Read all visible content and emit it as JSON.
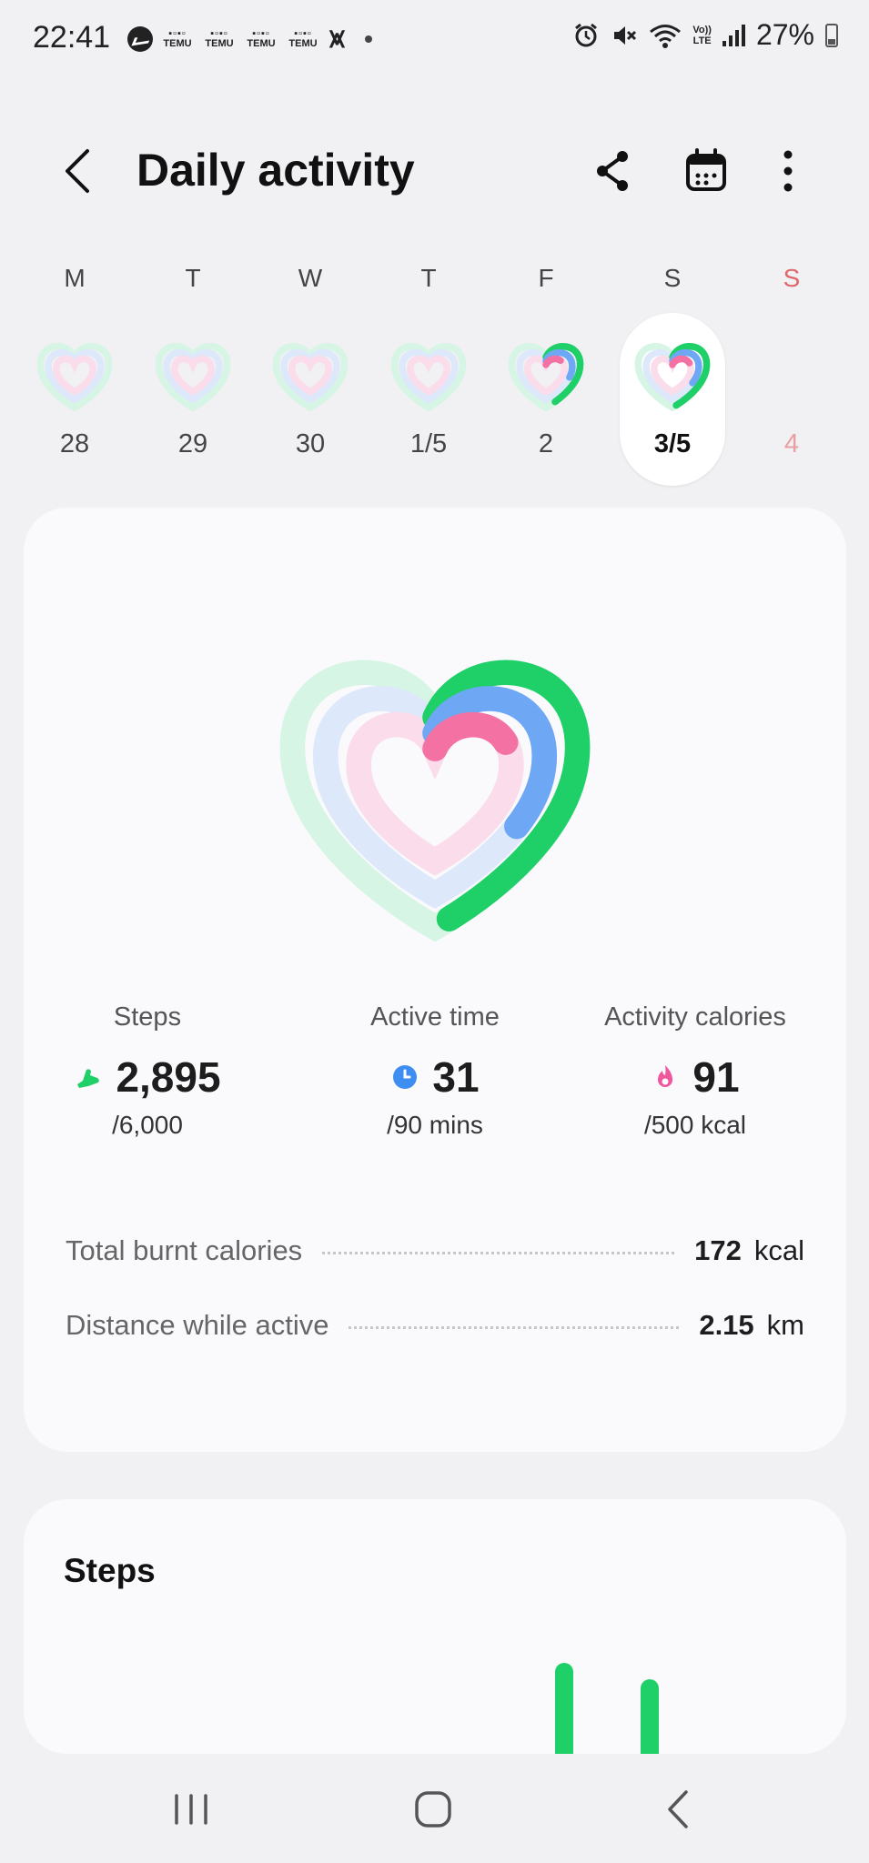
{
  "status_bar": {
    "time": "22:41",
    "temu_label": "TEMU",
    "battery": "27%",
    "icons": [
      "messenger-icon",
      "temu-icon",
      "capcut-icon",
      "alarm-icon",
      "mute-icon",
      "wifi-icon",
      "volte-icon",
      "signal-icon",
      "battery-icon"
    ],
    "volte_top": "Vo))",
    "volte_bottom": "LTE"
  },
  "header": {
    "title": "Daily activity",
    "icons": [
      "back-icon",
      "share-icon",
      "calendar-icon",
      "more-vert-icon"
    ]
  },
  "week": [
    {
      "letter": "M",
      "date": "28",
      "progress": {
        "steps": 0,
        "active": 0,
        "calories": 0
      }
    },
    {
      "letter": "T",
      "date": "29",
      "progress": {
        "steps": 0,
        "active": 0,
        "calories": 0
      }
    },
    {
      "letter": "W",
      "date": "30",
      "progress": {
        "steps": 0,
        "active": 0,
        "calories": 0
      }
    },
    {
      "letter": "T",
      "date": "1/5",
      "progress": {
        "steps": 0,
        "active": 0,
        "calories": 0
      }
    },
    {
      "letter": "F",
      "date": "2",
      "progress": {
        "steps": 0.45,
        "active": 0.3,
        "calories": 0.15
      }
    },
    {
      "letter": "S",
      "date": "3/5",
      "selected": true,
      "progress": {
        "steps": 0.48,
        "active": 0.34,
        "calories": 0.18
      }
    },
    {
      "letter": "S",
      "date": "4",
      "sunday": true
    }
  ],
  "summary": {
    "steps": {
      "label": "Steps",
      "value": "2,895",
      "goal": "/6,000",
      "icon": "shoe-icon",
      "color": "#1fcf68"
    },
    "active_time": {
      "label": "Active time",
      "value": "31",
      "goal": "/90 mins",
      "icon": "clock-icon",
      "color": "#3d8ef0"
    },
    "calories": {
      "label": "Activity calories",
      "value": "91",
      "goal": "/500 kcal",
      "icon": "flame-icon",
      "color": "#f0569b"
    },
    "ring_progress": {
      "steps": 0.4825,
      "active": 0.3444,
      "calories": 0.182
    },
    "total_burnt": {
      "label": "Total burnt calories",
      "value": "172",
      "unit": "kcal"
    },
    "distance": {
      "label": "Distance while active",
      "value": "2.15",
      "unit": "km"
    }
  },
  "steps_card": {
    "title": "Steps",
    "bar_color": "#1fcf68"
  },
  "colors": {
    "steps_green": "#1fcf68",
    "active_blue": "#6ea8f5",
    "calories_pink": "#f471a4",
    "sunday_red": "#e0676a",
    "page_bg": "#f1f1f4",
    "card_bg": "#fafafd"
  },
  "nav": {
    "icons": [
      "recent-apps-icon",
      "home-icon",
      "back-nav-icon"
    ]
  }
}
